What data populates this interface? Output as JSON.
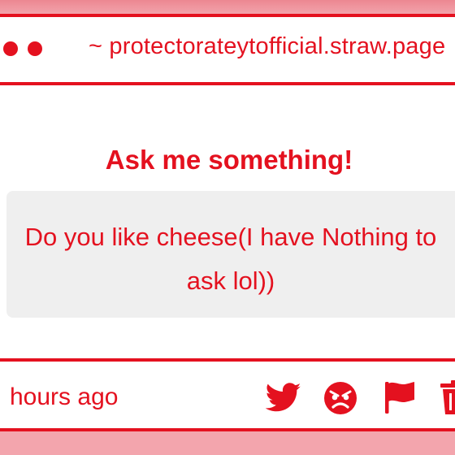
{
  "window": {
    "url": "~ protectorateytofficial.straw.page"
  },
  "main": {
    "heading": "Ask me something!",
    "question": "Do you like cheese(I have Nothing to ask lol))"
  },
  "footer": {
    "timestamp": "hours ago",
    "actions": [
      {
        "icon": "twitter-icon"
      },
      {
        "icon": "angry-face-icon"
      },
      {
        "icon": "flag-icon"
      },
      {
        "icon": "trash-icon"
      }
    ]
  },
  "colors": {
    "accent": "#e4111f",
    "background": "#f3a5ad",
    "card": "#efefef",
    "window": "#ffffff"
  }
}
